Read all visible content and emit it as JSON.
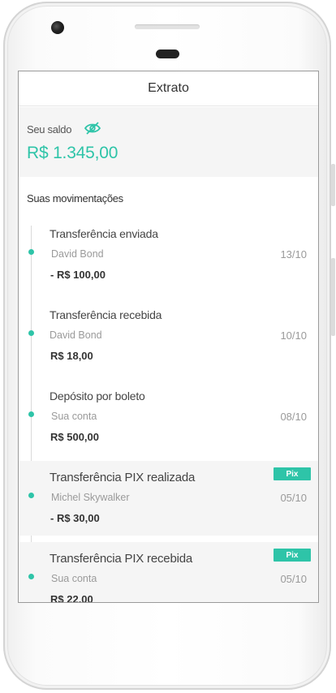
{
  "header": {
    "title": "Extrato"
  },
  "balance": {
    "label": "Seu saldo",
    "value": "R$ 1.345,00",
    "visibility_icon": "eye-slash-icon"
  },
  "movements": {
    "title": "Suas movimentações",
    "items": [
      {
        "title": "Transferência enviada",
        "party": "David Bond",
        "date": "13/10",
        "amount": "- R$ 100,00",
        "pix": false
      },
      {
        "title": "Transferência recebida",
        "party": "David Bond",
        "date": "10/10",
        "amount": "R$ 18,00",
        "pix": false
      },
      {
        "title": "Depósito por boleto",
        "party": "Sua conta",
        "date": "08/10",
        "amount": "R$ 500,00",
        "pix": false
      },
      {
        "title": "Transferência PIX realizada",
        "party": "Michel Skywalker",
        "date": "05/10",
        "amount": "- R$ 30,00",
        "pix": true,
        "badge": "Pix"
      },
      {
        "title": "Transferência PIX recebida",
        "party": "Sua conta",
        "date": "05/10",
        "amount": "R$ 22,00",
        "pix": true,
        "badge": "Pix"
      }
    ]
  },
  "colors": {
    "accent": "#2ec4a8",
    "text": "#333333",
    "muted": "#9a9a9a",
    "panel": "#f5f5f5"
  }
}
